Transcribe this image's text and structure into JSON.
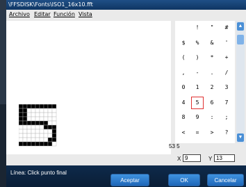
{
  "window": {
    "title": "\\FFSDISK\\Fonts\\ISO1_16x10.fft"
  },
  "menu": [
    "Archivo",
    "Editar",
    "Función",
    "Vista"
  ],
  "charmap": {
    "rows": [
      [
        "",
        "!",
        "\"",
        "#"
      ],
      [
        "$",
        "%",
        "&",
        "'"
      ],
      [
        "(",
        ")",
        "*",
        "+"
      ],
      [
        ",",
        "-",
        ".",
        "/"
      ],
      [
        "0",
        "1",
        "2",
        "3"
      ],
      [
        "4",
        "5",
        "6",
        "7"
      ],
      [
        "8",
        "9",
        ":",
        ";"
      ],
      [
        "<",
        "=",
        ">",
        "?"
      ]
    ],
    "selected": "5"
  },
  "char_code": "53 5",
  "coords": {
    "x_label": "X",
    "x_value": "9",
    "y_label": "Y",
    "y_value": "13"
  },
  "status": {
    "text": "Línea: Click punto final"
  },
  "buttons": {
    "accept": "Aceptar",
    "ok": "OK",
    "cancel": "Cancelar"
  },
  "icons": {
    "scroll_up": "chevron-up-icon",
    "scroll_down": "chevron-down-icon"
  },
  "colors": {
    "title_bar": "#1f4f86",
    "status_bar": "#0e2a4b",
    "button": "#2f7fd3",
    "selection": "#e03030"
  }
}
